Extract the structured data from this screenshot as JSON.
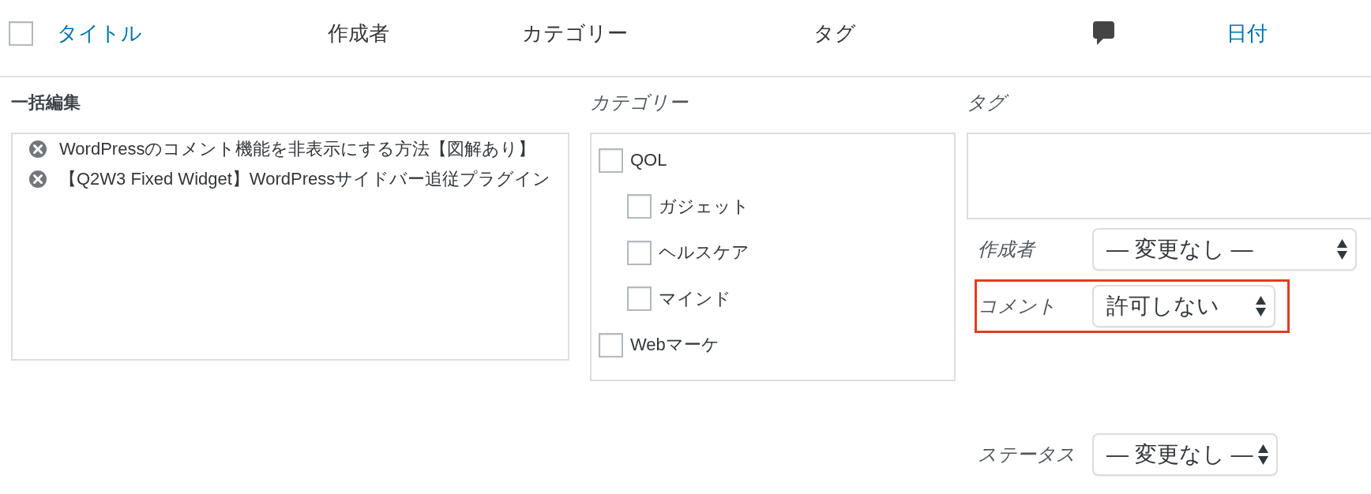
{
  "list_header": {
    "select_all": {
      "checked": false
    },
    "columns": [
      {
        "label": "タイトル",
        "kind": "link"
      },
      {
        "label": "作成者",
        "kind": "text"
      },
      {
        "label": "カテゴリー",
        "kind": "text"
      },
      {
        "label": "タグ",
        "kind": "text"
      },
      {
        "kind": "icon"
      },
      {
        "label": "日付",
        "kind": "link"
      }
    ]
  },
  "bulk_edit": {
    "title": "一括編集",
    "posts": [
      {
        "title": "WordPressのコメント機能を非表示にする方法【図解あり】"
      },
      {
        "title": "【Q2W3 Fixed Widget】WordPressサイドバー追従プラグイン"
      }
    ]
  },
  "categories": {
    "label": "カテゴリー",
    "items": [
      {
        "label": "QOL",
        "checked": false,
        "children": [
          {
            "label": "ガジェット",
            "checked": false
          },
          {
            "label": "ヘルスケア",
            "checked": false
          },
          {
            "label": "マインド",
            "checked": false
          }
        ]
      },
      {
        "label": "Webマーケ",
        "checked": false
      }
    ]
  },
  "tags": {
    "label": "タグ"
  },
  "fields": [
    {
      "label": "作成者",
      "value": "— 変更なし —",
      "highlighted": false
    },
    {
      "label": "コメント",
      "value": "許可しない",
      "highlighted": true
    },
    {
      "label": "ステータス",
      "value": "— 変更なし —",
      "highlighted": false
    }
  ]
}
